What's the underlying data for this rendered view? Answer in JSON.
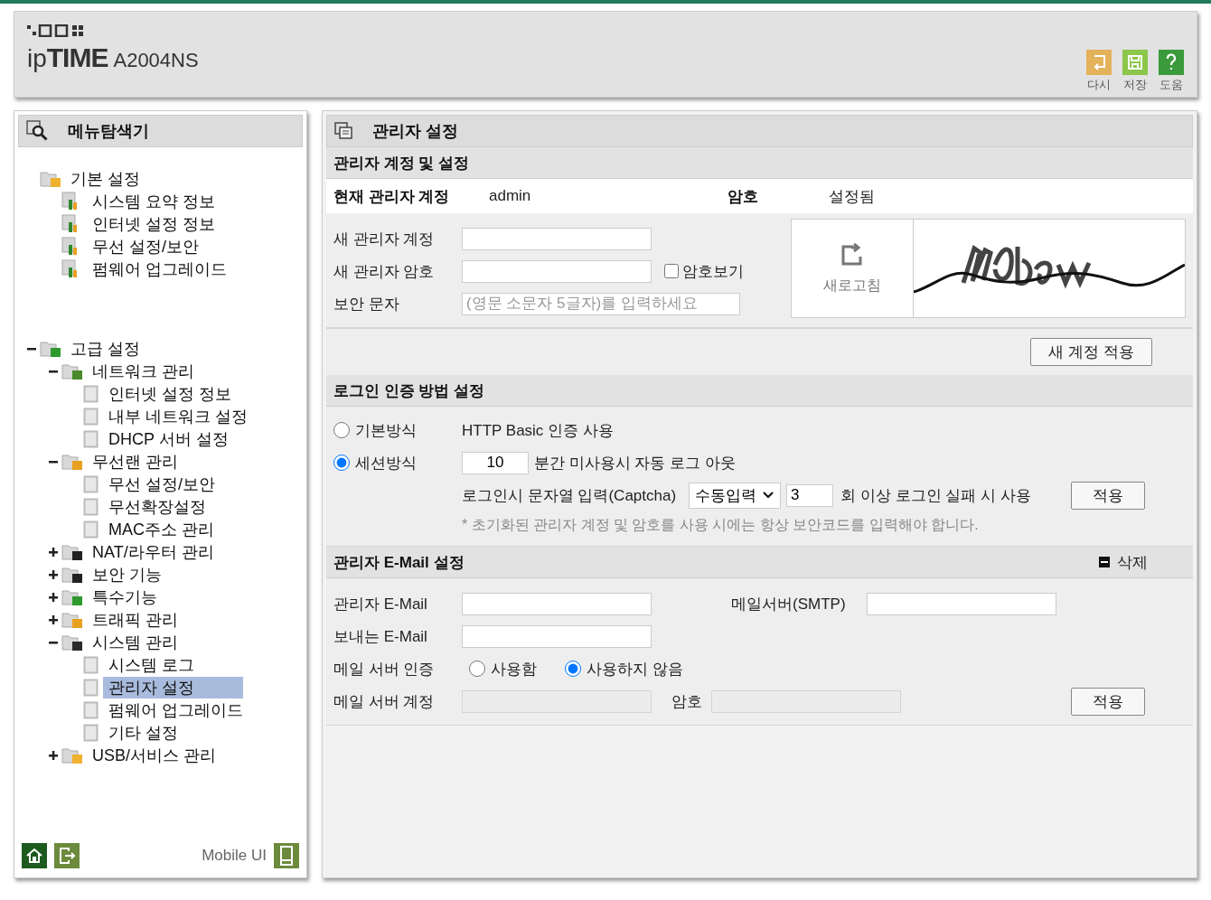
{
  "header": {
    "logo": {
      "brand_prefix": "ip",
      "brand_main": "TIME",
      "model": "A2004NS"
    },
    "actions": [
      {
        "label": "다시"
      },
      {
        "label": "저장"
      },
      {
        "label": "도움"
      }
    ]
  },
  "sidebar": {
    "title": "메뉴탐색기",
    "tree": [
      {
        "label": "기본 설정",
        "selected": false,
        "children": [
          {
            "label": "시스템 요약 정보",
            "selected": false
          },
          {
            "label": "인터넷 설정 정보",
            "selected": false
          },
          {
            "label": "무선 설정/보안",
            "selected": false
          },
          {
            "label": "펌웨어 업그레이드",
            "selected": false
          }
        ]
      },
      {
        "label": "고급 설정",
        "selected": false,
        "expanded": true,
        "children": [
          {
            "label": "네트워크 관리",
            "selected": false,
            "expanded": true,
            "children": [
              {
                "label": "인터넷 설정 정보",
                "selected": false
              },
              {
                "label": "내부 네트워크 설정",
                "selected": false
              },
              {
                "label": "DHCP 서버 설정",
                "selected": false
              }
            ]
          },
          {
            "label": "무선랜 관리",
            "selected": false,
            "expanded": true,
            "children": [
              {
                "label": "무선 설정/보안",
                "selected": false
              },
              {
                "label": "무선확장설정",
                "selected": false
              },
              {
                "label": "MAC주소 관리",
                "selected": false
              }
            ]
          },
          {
            "label": "NAT/라우터 관리",
            "selected": false,
            "expanded": false
          },
          {
            "label": "보안 기능",
            "selected": false,
            "expanded": false
          },
          {
            "label": "특수기능",
            "selected": false,
            "expanded": false
          },
          {
            "label": "트래픽 관리",
            "selected": false,
            "expanded": false
          },
          {
            "label": "시스템 관리",
            "selected": false,
            "expanded": true,
            "children": [
              {
                "label": "시스템 로그",
                "selected": false
              },
              {
                "label": "관리자 설정",
                "selected": true
              },
              {
                "label": "펌웨어 업그레이드",
                "selected": false
              },
              {
                "label": "기타 설정",
                "selected": false
              }
            ]
          },
          {
            "label": "USB/서비스 관리",
            "selected": false,
            "expanded": false
          }
        ]
      }
    ],
    "footer": {
      "mobile_label": "Mobile UI"
    }
  },
  "main": {
    "title": "관리자 설정",
    "account": {
      "heading": "관리자 계정 및 설정",
      "current_label": "현재 관리자 계정",
      "current_value": "admin",
      "password_label": "암호",
      "password_value": "설정됨",
      "fields": [
        {
          "label": "새 관리자 계정"
        },
        {
          "label": "새 관리자 암호",
          "show_password": {
            "label": "암호보기",
            "checked": false
          }
        },
        {
          "label": "보안 문자",
          "placeholder": "(영문 소문자 5글자)를 입력하세요"
        }
      ],
      "refresh_label": "새로고침",
      "apply": "새 계정 적용"
    },
    "login": {
      "heading": "로그인 인증 방법 설정",
      "options": [
        {
          "kind": "text",
          "label": "기본방식",
          "selected": false,
          "description": "HTTP Basic 인증 사용"
        },
        {
          "kind": "timeout",
          "label": "세션방식",
          "selected": true,
          "minutes": "10",
          "description": "분간 미사용시 자동 로그 아웃"
        }
      ],
      "captcha_label": "로그인시 문자열 입력(Captcha)",
      "captcha_mode": "수동입력",
      "captcha_count": "3",
      "captcha_suffix": "회 이상 로그인 실패 시 사용",
      "apply": "적용",
      "note": "* 초기화된 관리자 계정 및 암호를 사용 시에는 항상 보안코드를 입력해야 합니다."
    },
    "email": {
      "heading": "관리자 E-Mail 설정",
      "delete": "삭제",
      "admin_email_label": "관리자 E-Mail",
      "smtp_label": "메일서버(SMTP)",
      "sender_label": "보내는 E-Mail",
      "auth_label": "메일 서버 인증",
      "auth_options": [
        {
          "label": "사용함",
          "selected": false
        },
        {
          "label": "사용하지 않음",
          "selected": true
        }
      ],
      "account_label": "메일 서버 계정",
      "password_label": "암호",
      "disabled": true,
      "apply": "적용"
    }
  }
}
